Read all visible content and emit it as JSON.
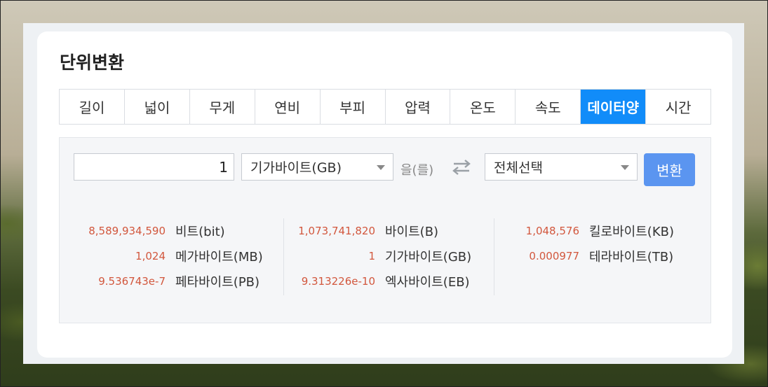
{
  "title": "단위변환",
  "tabs": [
    {
      "label": "길이",
      "active": false
    },
    {
      "label": "넓이",
      "active": false
    },
    {
      "label": "무게",
      "active": false
    },
    {
      "label": "연비",
      "active": false
    },
    {
      "label": "부피",
      "active": false
    },
    {
      "label": "압력",
      "active": false
    },
    {
      "label": "온도",
      "active": false
    },
    {
      "label": "속도",
      "active": false
    },
    {
      "label": "데이터양",
      "active": true
    },
    {
      "label": "시간",
      "active": false
    }
  ],
  "converter": {
    "input_value": "1",
    "from_unit": "기가바이트(GB)",
    "particle": "을(를)",
    "to_unit": "전체선택",
    "convert_label": "변환",
    "swap_icon": "swap-arrows-icon"
  },
  "results": [
    [
      {
        "value": "8,589,934,590",
        "unit": "비트(bit)"
      },
      {
        "value": "1,024",
        "unit": "메가바이트(MB)"
      },
      {
        "value": "9.536743e-7",
        "unit": "페타바이트(PB)"
      }
    ],
    [
      {
        "value": "1,073,741,820",
        "unit": "바이트(B)"
      },
      {
        "value": "1",
        "unit": "기가바이트(GB)"
      },
      {
        "value": "9.313226e-10",
        "unit": "엑사바이트(EB)"
      }
    ],
    [
      {
        "value": "1,048,576",
        "unit": "킬로바이트(KB)"
      },
      {
        "value": "0.000977",
        "unit": "테라바이트(TB)"
      }
    ]
  ],
  "colors": {
    "active_tab": "#118cf9",
    "convert_button": "#5b95f0",
    "result_value": "#d2573d"
  }
}
